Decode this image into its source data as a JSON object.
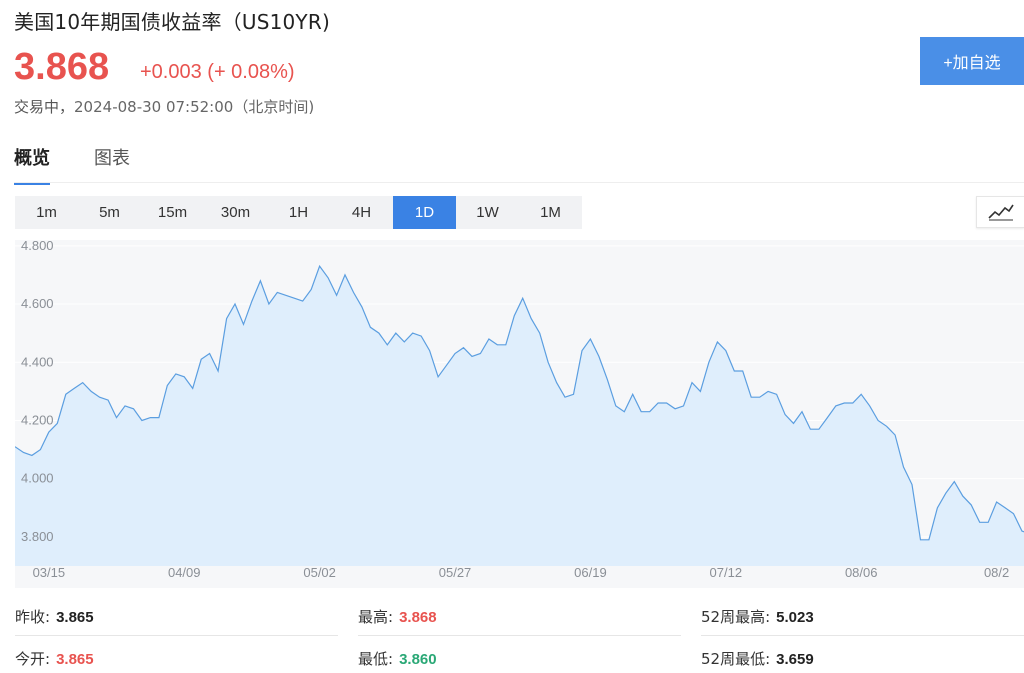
{
  "header": {
    "title": "美国10年期国债收益率（US10YR)",
    "price": "3.868",
    "change": "+0.003 (+ 0.08%)",
    "status": "交易中，",
    "timestamp": "2024-08-30 07:52:00（北京时间)",
    "add_button": "+加自选"
  },
  "tabs": [
    "概览",
    "图表"
  ],
  "periods": [
    "1m",
    "5m",
    "15m",
    "30m",
    "1H",
    "4H",
    "1D",
    "1W",
    "1M"
  ],
  "active_period": "1D",
  "chart_type_icon": "line-chart-icon",
  "colors": {
    "up": "#e8534f",
    "down": "#2aa876",
    "accent": "#3a82e4",
    "line": "#5b9ee0",
    "fill": "#dfeefc"
  },
  "stats": {
    "prev_close_label": "昨收:",
    "prev_close": "3.865",
    "high_label": "最高:",
    "high": "3.868",
    "week52_high_label": "52周最高:",
    "week52_high": "5.023",
    "open_label": "今开:",
    "open": "3.865",
    "low_label": "最低:",
    "low": "3.860",
    "week52_low_label": "52周最低:",
    "week52_low": "3.659"
  },
  "chart_data": {
    "type": "area",
    "ylim": [
      3.7,
      4.82
    ],
    "y_ticks": [
      "4.800",
      "4.600",
      "4.400",
      "4.200",
      "4.000",
      "3.800"
    ],
    "y_tick_values": [
      4.8,
      4.6,
      4.4,
      4.2,
      4.0,
      3.8
    ],
    "x_ticks": [
      {
        "label": "03/15",
        "index": 4
      },
      {
        "label": "04/09",
        "index": 20
      },
      {
        "label": "05/02",
        "index": 36
      },
      {
        "label": "05/27",
        "index": 52
      },
      {
        "label": "06/19",
        "index": 68
      },
      {
        "label": "07/12",
        "index": 84
      },
      {
        "label": "08/06",
        "index": 100
      },
      {
        "label": "08/2",
        "index": 116
      }
    ],
    "n_points": 120,
    "values": [
      4.11,
      4.09,
      4.08,
      4.1,
      4.16,
      4.19,
      4.29,
      4.31,
      4.33,
      4.3,
      4.28,
      4.27,
      4.21,
      4.25,
      4.24,
      4.2,
      4.21,
      4.21,
      4.32,
      4.36,
      4.35,
      4.31,
      4.41,
      4.43,
      4.37,
      4.55,
      4.6,
      4.53,
      4.61,
      4.68,
      4.6,
      4.64,
      4.63,
      4.62,
      4.61,
      4.65,
      4.73,
      4.69,
      4.63,
      4.7,
      4.64,
      4.59,
      4.52,
      4.5,
      4.46,
      4.5,
      4.47,
      4.5,
      4.49,
      4.44,
      4.35,
      4.39,
      4.43,
      4.45,
      4.42,
      4.43,
      4.48,
      4.46,
      4.46,
      4.56,
      4.62,
      4.55,
      4.5,
      4.4,
      4.33,
      4.28,
      4.29,
      4.44,
      4.48,
      4.42,
      4.34,
      4.25,
      4.23,
      4.29,
      4.23,
      4.23,
      4.26,
      4.26,
      4.24,
      4.25,
      4.33,
      4.3,
      4.4,
      4.47,
      4.44,
      4.37,
      4.37,
      4.28,
      4.28,
      4.3,
      4.29,
      4.22,
      4.19,
      4.23,
      4.17,
      4.17,
      4.21,
      4.25,
      4.26,
      4.26,
      4.29,
      4.25,
      4.2,
      4.18,
      4.15,
      4.04,
      3.98,
      3.79,
      3.79,
      3.9,
      3.95,
      3.99,
      3.94,
      3.91,
      3.85,
      3.85,
      3.92,
      3.9,
      3.88,
      3.82,
      3.81,
      3.86,
      3.81,
      3.82,
      3.82,
      3.85,
      3.87
    ]
  }
}
